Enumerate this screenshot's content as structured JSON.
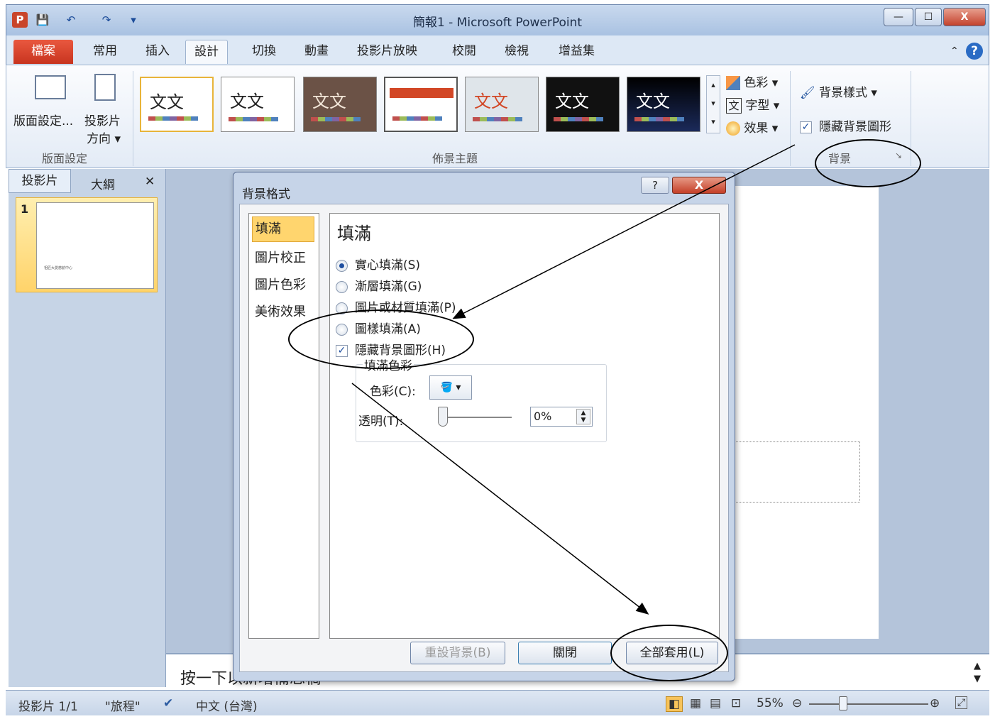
{
  "window": {
    "title": "簡報1 - Microsoft PowerPoint",
    "logo": "P",
    "controls": [
      "—",
      "☐",
      "X"
    ]
  },
  "quick_access": {
    "save": "💾",
    "undo": "↶",
    "redo": "↷",
    "customize": "▾"
  },
  "tabs": [
    {
      "label": "檔案"
    },
    {
      "label": "常用"
    },
    {
      "label": "插入"
    },
    {
      "label": "設計"
    },
    {
      "label": "切換"
    },
    {
      "label": "動畫"
    },
    {
      "label": "投影片放映"
    },
    {
      "label": "校閱"
    },
    {
      "label": "檢視"
    },
    {
      "label": "增益集"
    }
  ],
  "ribbon": {
    "page_setup": {
      "btn1": "版面設定...",
      "btn2_line1": "投影片",
      "btn2_line2": "方向 ▾",
      "label": "版面設定"
    },
    "themes": {
      "label": "佈景主題",
      "sample_text": "文文",
      "colors": "色彩 ▾",
      "fonts": "字型 ▾",
      "effects": "效果 ▾",
      "font_icon": "文"
    },
    "background": {
      "styles": "背景樣式 ▾",
      "hide_graphics": "隱藏背景圖形",
      "label": "背景",
      "launcher": "↘"
    }
  },
  "left_panel": {
    "tab_slides": "投影片",
    "tab_outline": "大綱",
    "close": "✕",
    "slide_number": "1",
    "thumb_text": "祖匠大愛慈航中心"
  },
  "notes": {
    "placeholder": "按一下以新增備忘稿"
  },
  "status": {
    "slide": "投影片 1/1",
    "theme": "\"旅程\"",
    "language": "中文 (台灣)",
    "zoom": "55%"
  },
  "dialog": {
    "title": "背景格式",
    "help": "?",
    "close": "X",
    "nav": [
      "填滿",
      "圖片校正",
      "圖片色彩",
      "美術效果"
    ],
    "section_title": "填滿",
    "options": [
      {
        "label": "實心填滿(S)",
        "selected": true
      },
      {
        "label": "漸層填滿(G)",
        "selected": false
      },
      {
        "label": "圖片或材質填滿(P)",
        "selected": false
      },
      {
        "label": "圖樣填滿(A)",
        "selected": false
      }
    ],
    "hide_bg_graphics": "隱藏背景圖形(H)",
    "fill_color_label": "填滿色彩",
    "color_label": "色彩(C):",
    "transparency_label": "透明(T):",
    "transparency_value": "0%",
    "btn_reset": "重設背景(B)",
    "btn_close": "關閉",
    "btn_apply_all": "全部套用(L)"
  }
}
